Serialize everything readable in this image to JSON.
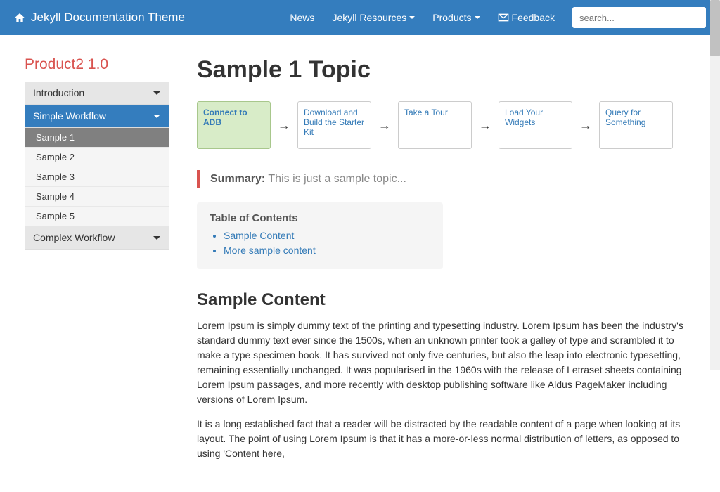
{
  "navbar": {
    "brand": "Jekyll Documentation Theme",
    "links": {
      "news": "News",
      "resources": "Jekyll Resources",
      "products": "Products",
      "feedback": "Feedback"
    },
    "search_placeholder": "search..."
  },
  "sidebar": {
    "title": "Product2 1.0",
    "sections": {
      "intro": "Introduction",
      "simple": "Simple Workflow",
      "complex": "Complex Workflow"
    },
    "items": {
      "s1": "Sample 1",
      "s2": "Sample 2",
      "s3": "Sample 3",
      "s4": "Sample 4",
      "s5": "Sample 5"
    }
  },
  "page": {
    "title": "Sample 1 Topic",
    "workflow": {
      "step1": "Connect to ADB",
      "step2": "Download and Build the Starter Kit",
      "step3": "Take a Tour",
      "step4": "Load Your Widgets",
      "step5": "Query for Something"
    },
    "summary_label": "Summary:",
    "summary_text": "This is just a sample topic...",
    "toc_title": "Table of Contents",
    "toc": {
      "t1": "Sample Content",
      "t2": "More sample content"
    },
    "h2": "Sample Content",
    "p1": "Lorem Ipsum is simply dummy text of the printing and typesetting industry. Lorem Ipsum has been the industry's standard dummy text ever since the 1500s, when an unknown printer took a galley of type and scrambled it to make a type specimen book. It has survived not only five centuries, but also the leap into electronic typesetting, remaining essentially unchanged. It was popularised in the 1960s with the release of Letraset sheets containing Lorem Ipsum passages, and more recently with desktop publishing software like Aldus PageMaker including versions of Lorem Ipsum.",
    "p2": "It is a long established fact that a reader will be distracted by the readable content of a page when looking at its layout. The point of using Lorem Ipsum is that it has a more-or-less normal distribution of letters, as opposed to using 'Content here,"
  }
}
